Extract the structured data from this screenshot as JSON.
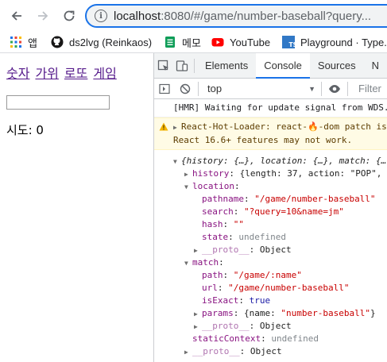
{
  "browser": {
    "url_host": "localhost",
    "url_rest": ":8080/#/game/number-baseball?query...",
    "bookmarks": [
      {
        "label": "앱",
        "icon": "apps-grid-icon"
      },
      {
        "label": "ds2lvg (Reinkaos)",
        "icon": "github-icon"
      },
      {
        "label": "메모",
        "icon": "memo-icon"
      },
      {
        "label": "YouTube",
        "icon": "youtube-icon"
      },
      {
        "label": "Playground · Type...",
        "icon": "typescript-icon"
      }
    ]
  },
  "page": {
    "menu": [
      "숫자",
      "가위",
      "로또",
      "게임"
    ],
    "input_value": "",
    "tries_label": "시도: 0"
  },
  "devtools": {
    "tabs": [
      "Elements",
      "Console",
      "Sources",
      "N"
    ],
    "active_tab": "Console",
    "context": "top",
    "filter_placeholder": "Filter",
    "messages": {
      "hmr": "[HMR] Waiting for update signal from WDS...",
      "warn_line1": "React-Hot-Loader: react-🔥-dom patch is",
      "warn_line2": "React 16.6+ features may not work."
    },
    "tree": {
      "root": "{history: {…}, location: {…}, match: {…",
      "history_key": "history",
      "history_val": "{length: 37, action: \"POP\",",
      "location_key": "location",
      "pathname_key": "pathname",
      "pathname_val": "\"/game/number-baseball\"",
      "search_key": "search",
      "search_val": "\"?query=10&name=jm\"",
      "hash_key": "hash",
      "hash_val": "\"\"",
      "state_key": "state",
      "state_val": "undefined",
      "proto_key": "__proto__",
      "proto_val": "Object",
      "match_key": "match",
      "path_key": "path",
      "path_val": "\"/game/:name\"",
      "url_key": "url",
      "url_val": "\"/game/number-baseball\"",
      "isExact_key": "isExact",
      "isExact_val": "true",
      "params_key": "params",
      "params_val_pre": "{name: ",
      "params_val_str": "\"number-baseball\"",
      "params_val_post": "}",
      "staticContext_key": "staticContext",
      "staticContext_val": "undefined"
    }
  }
}
